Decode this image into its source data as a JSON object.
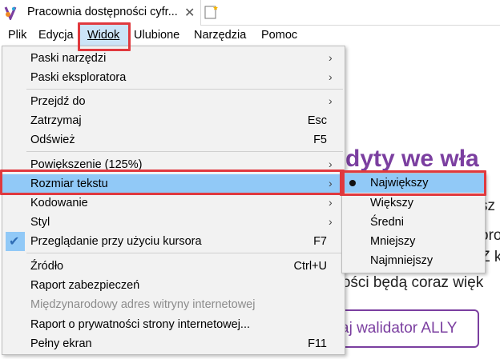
{
  "tab": {
    "title": "Pracownia dostępności cyfr...",
    "close_icon": "close-icon",
    "favicon": "app-logo-icon",
    "newtab_icon": "new-tab-icon"
  },
  "menubar": {
    "items": [
      "Plik",
      "Edycja",
      "Widok",
      "Ulubione",
      "Narzędzia",
      "Pomoc"
    ],
    "active": "Widok"
  },
  "page": {
    "heading_fragment": "dyty we wła",
    "text_lines": [
      "sz",
      "oro",
      "Z k",
      "tności będą coraz więk"
    ],
    "button_label": "aj walidator ALLY",
    "accent_color": "#7b3fa0"
  },
  "dropdown": {
    "items": [
      {
        "label": "Paski narzędzi",
        "submenu": true
      },
      {
        "label": "Paski eksploratora",
        "submenu": true
      },
      {
        "label": "Przejdź do",
        "submenu": true
      },
      {
        "label": "Zatrzymaj",
        "shortcut": "Esc"
      },
      {
        "label": "Odśwież",
        "shortcut": "F5"
      },
      {
        "label": "Powiększenie (125%)",
        "submenu": true
      },
      {
        "label": "Rozmiar tekstu",
        "submenu": true,
        "selected": true
      },
      {
        "label": "Kodowanie",
        "submenu": true
      },
      {
        "label": "Styl",
        "submenu": true
      },
      {
        "label": "Przeglądanie przy użyciu kursora",
        "shortcut": "F7",
        "checked": true
      },
      {
        "label": "Źródło",
        "shortcut": "Ctrl+U"
      },
      {
        "label": "Raport zabezpieczeń"
      },
      {
        "label": "Międzynarodowy adres witryny internetowej",
        "disabled": true
      },
      {
        "label": "Raport o prywatności strony internetowej..."
      },
      {
        "label": "Pełny ekran",
        "shortcut": "F11"
      }
    ]
  },
  "submenu": {
    "items": [
      {
        "label": "Największy",
        "selected": true
      },
      {
        "label": "Większy"
      },
      {
        "label": "Średni"
      },
      {
        "label": "Mniejszy"
      },
      {
        "label": "Najmniejszy"
      }
    ]
  },
  "colors": {
    "highlight": "#e0393e",
    "selection": "#91c9f7",
    "menu_bg": "#f2f2f2"
  }
}
